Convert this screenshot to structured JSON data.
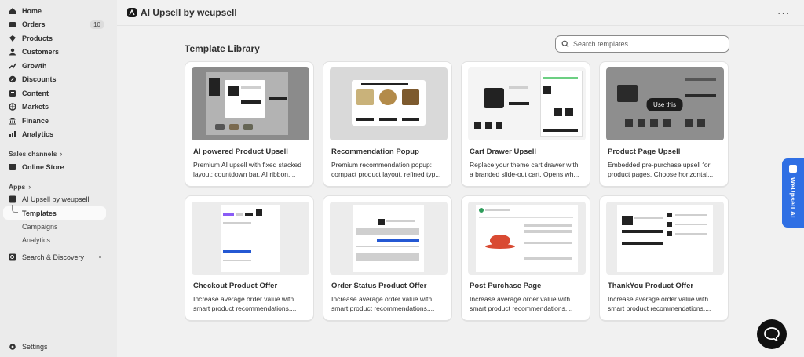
{
  "sidebar": {
    "items": [
      {
        "label": "Home",
        "icon": "home-icon"
      },
      {
        "label": "Orders",
        "icon": "orders-icon",
        "badge": "10"
      },
      {
        "label": "Products",
        "icon": "products-icon"
      },
      {
        "label": "Customers",
        "icon": "customers-icon"
      },
      {
        "label": "Growth",
        "icon": "growth-icon"
      },
      {
        "label": "Discounts",
        "icon": "discounts-icon"
      },
      {
        "label": "Content",
        "icon": "content-icon"
      },
      {
        "label": "Markets",
        "icon": "markets-icon"
      },
      {
        "label": "Finance",
        "icon": "finance-icon"
      },
      {
        "label": "Analytics",
        "icon": "analytics-icon"
      }
    ],
    "sales_channels_label": "Sales channels",
    "online_store": "Online Store",
    "apps_label": "Apps",
    "app_name": "AI Upsell by weupsell",
    "app_sub": [
      "Templates",
      "Campaigns",
      "Analytics"
    ],
    "search_discovery": "Search & Discovery",
    "settings": "Settings"
  },
  "header": {
    "title": "AI Upsell by weupsell"
  },
  "main": {
    "title": "Template Library",
    "search_placeholder": "Search templates...",
    "hover_button": "Use this",
    "cards": [
      {
        "title": "AI powered Product Upsell",
        "desc": "Premium AI upsell with fixed stacked layout: countdown bar, AI ribbon,..."
      },
      {
        "title": "Recommendation Popup",
        "desc": "Premium recommendation popup: compact product layout, refined typ..."
      },
      {
        "title": "Cart Drawer Upsell",
        "desc": "Replace your theme cart drawer with a branded slide-out cart. Opens wh..."
      },
      {
        "title": "Product Page Upsell",
        "desc": "Embedded pre-purchase upsell for product pages. Choose horizontal..."
      },
      {
        "title": "Checkout Product Offer",
        "desc": "Increase average order value with smart product recommendations...."
      },
      {
        "title": "Order Status Product Offer",
        "desc": "Increase average order value with smart product recommendations...."
      },
      {
        "title": "Post Purchase Page",
        "desc": "Increase average order value with smart product recommendations...."
      },
      {
        "title": "ThankYou Product Offer",
        "desc": "Increase average order value with smart product recommendations...."
      }
    ]
  },
  "side_tab": {
    "label": "WeUpsell AI"
  },
  "colors": {
    "accent_blue": "#2f6fe4",
    "background": "#f1f1f1"
  }
}
